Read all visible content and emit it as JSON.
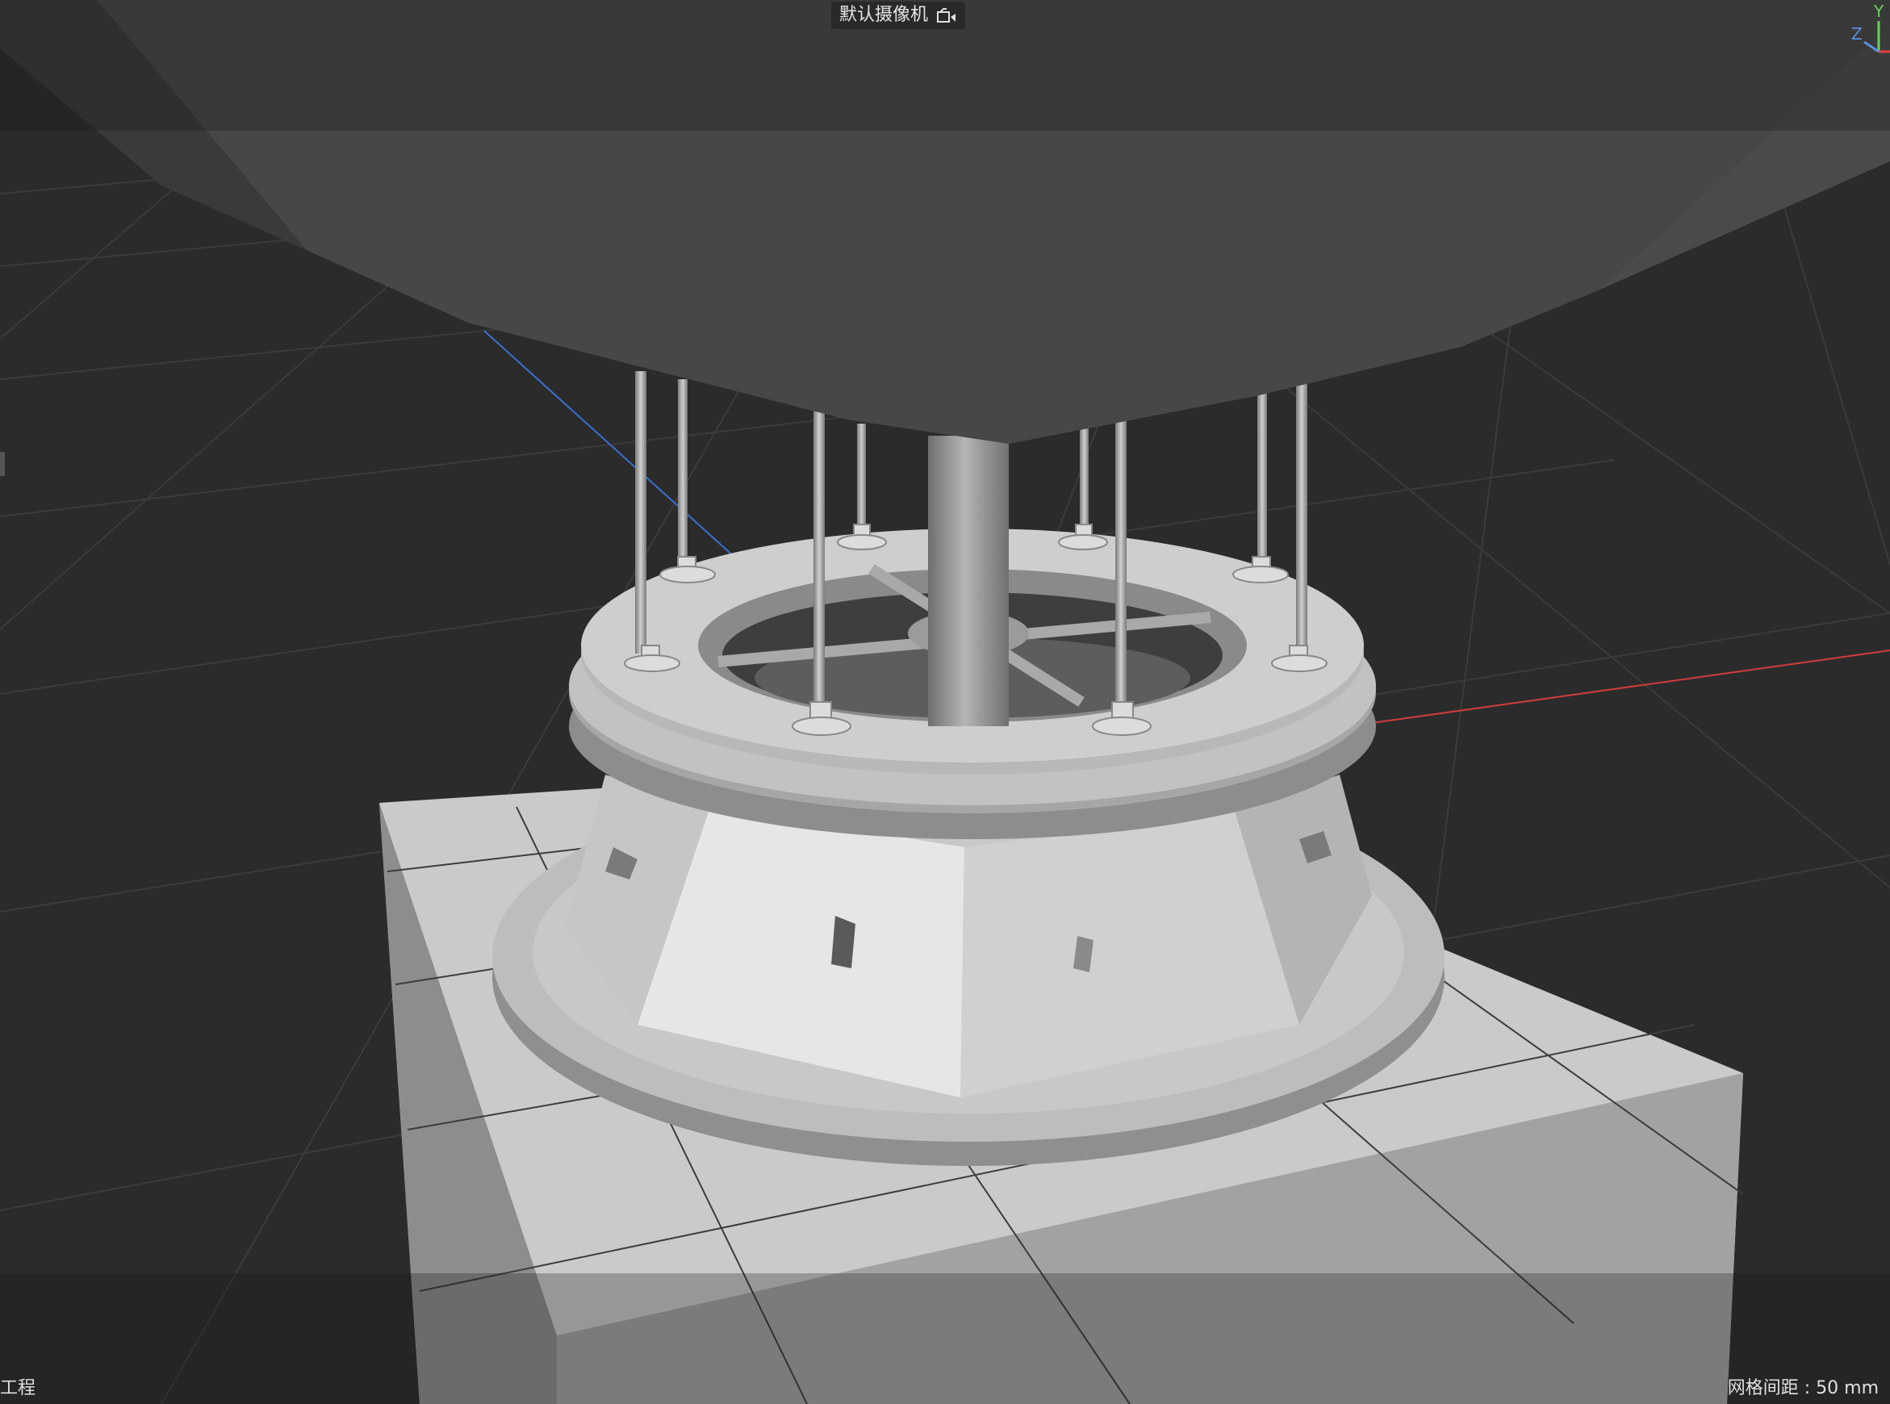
{
  "viewport": {
    "camera_label": "默认摄像机",
    "camera_icon": "camera-toggle-icon",
    "axis_gizmo": {
      "y_label": "Y",
      "z_label": "Z",
      "x_color": "#e04040",
      "y_color": "#6ccf5a",
      "z_color": "#5a8fe0"
    },
    "status_left": "工程",
    "grid_spacing": "网格间距 : 50 mm"
  },
  "colors": {
    "background": "#2b2b2b",
    "grid_line": "#3a3a3a",
    "x_axis": "#d23c3c",
    "z_axis": "#3a6fd0",
    "model_light": "#d8d8d8",
    "model_mid": "#a9a9a9",
    "model_dark": "#7c7c7c",
    "overhead": "#464646"
  }
}
